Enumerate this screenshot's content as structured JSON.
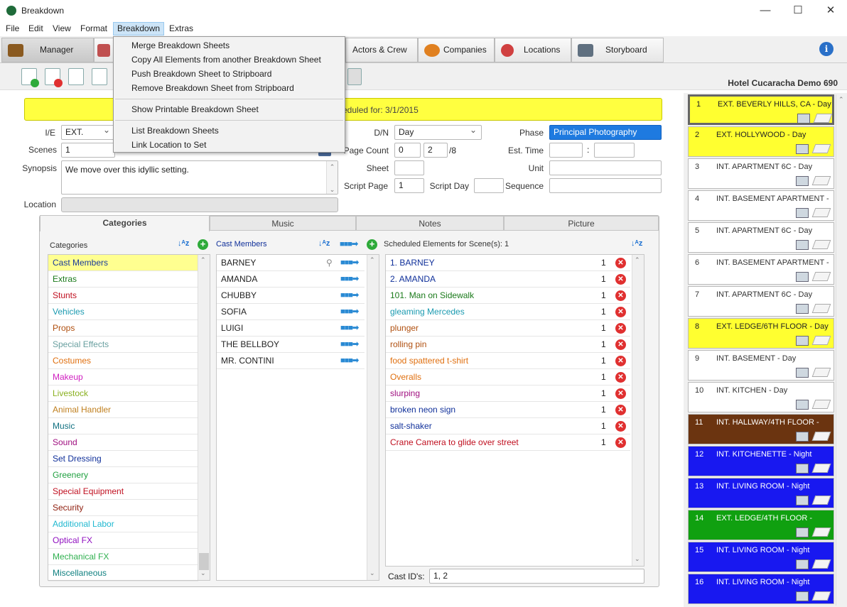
{
  "window": {
    "title": "Breakdown",
    "minimize": "—",
    "maximize": "☐",
    "close": "✕"
  },
  "menubar": [
    "File",
    "Edit",
    "View",
    "Format",
    "Breakdown",
    "Extras"
  ],
  "main_tabs": [
    {
      "label": "Manager",
      "icon": "briefcase-icon"
    },
    {
      "label": "Actors & Crew",
      "icon": "actors-icon"
    },
    {
      "label": "Companies",
      "icon": "companies-icon"
    },
    {
      "label": "Locations",
      "icon": "locations-icon"
    },
    {
      "label": "Storyboard",
      "icon": "storyboard-icon"
    }
  ],
  "project_name": "Hotel Cucaracha Demo 690",
  "breakdown_menu": {
    "items": [
      "Merge Breakdown Sheets",
      "Copy All Elements from another Breakdown Sheet",
      "Push Breakdown Sheet to Stripboard",
      "Remove Breakdown Sheet from Stripboard",
      "Show Printable Breakdown Sheet",
      "List Breakdown Sheets",
      "Link Location to Set"
    ]
  },
  "header_bar": {
    "text": "eduled for: 3/1/2015"
  },
  "form": {
    "ie_label": "I/E",
    "ie_value": "EXT.",
    "scenes_label": "Scenes",
    "scenes_value": "1",
    "synopsis_label": "Synopsis",
    "synopsis_value": "We move over this idyllic setting.",
    "location_label": "Location",
    "dn_label": "D/N",
    "dn_value": "Day",
    "phase_label": "Phase",
    "phase_value": "Principal Photography",
    "pagecount_label": "Page Count",
    "pagecount_whole": "0",
    "pagecount_num": "2",
    "pagecount_den": "/8",
    "esttime_label": "Est. Time",
    "esttime_sep": ":",
    "sheet_label": "Sheet",
    "unit_label": "Unit",
    "scriptpage_label": "Script Page",
    "scriptpage_value": "1",
    "scriptday_label": "Script Day",
    "sequence_label": "Sequence"
  },
  "panel_tabs": [
    "Categories",
    "Music",
    "Notes",
    "Picture"
  ],
  "categories": {
    "header": "Categories",
    "items": [
      {
        "label": "Cast Members",
        "color": "#1a3a9a"
      },
      {
        "label": "Extras",
        "color": "#1a7a1a"
      },
      {
        "label": "Stunts",
        "color": "#c01020"
      },
      {
        "label": "Vehicles",
        "color": "#1a9ab0"
      },
      {
        "label": "Props",
        "color": "#b05010"
      },
      {
        "label": "Special Effects",
        "color": "#6aa0a0"
      },
      {
        "label": "Costumes",
        "color": "#e07010"
      },
      {
        "label": "Makeup",
        "color": "#d020c0"
      },
      {
        "label": "Livestock",
        "color": "#8ab020"
      },
      {
        "label": "Animal Handler",
        "color": "#c08020"
      },
      {
        "label": "Music",
        "color": "#107080"
      },
      {
        "label": "Sound",
        "color": "#a01080"
      },
      {
        "label": "Set Dressing",
        "color": "#10309a"
      },
      {
        "label": "Greenery",
        "color": "#20a040"
      },
      {
        "label": "Special Equipment",
        "color": "#c01020"
      },
      {
        "label": "Security",
        "color": "#902010"
      },
      {
        "label": "Additional Labor",
        "color": "#20b8d0"
      },
      {
        "label": "Optical FX",
        "color": "#9010c0"
      },
      {
        "label": "Mechanical FX",
        "color": "#30b050"
      },
      {
        "label": "Miscellaneous",
        "color": "#108080"
      }
    ]
  },
  "cast": {
    "header": "Cast Members",
    "items": [
      "BARNEY",
      "AMANDA",
      "CHUBBY",
      "SOFIA",
      "LUIGI",
      "THE BELLBOY",
      "MR. CONTINI"
    ]
  },
  "scheduled": {
    "header": "Scheduled Elements for Scene(s): 1",
    "items": [
      {
        "label": "1. BARNEY",
        "qty": "1",
        "color": "#10309a"
      },
      {
        "label": "2. AMANDA",
        "qty": "1",
        "color": "#10309a"
      },
      {
        "label": "101. Man on Sidewalk",
        "qty": "1",
        "color": "#1a7a1a"
      },
      {
        "label": "gleaming Mercedes",
        "qty": "1",
        "color": "#1a9ab0"
      },
      {
        "label": "plunger",
        "qty": "1",
        "color": "#b05010"
      },
      {
        "label": "rolling pin",
        "qty": "1",
        "color": "#b05010"
      },
      {
        "label": "food spattered t-shirt",
        "qty": "1",
        "color": "#e07010"
      },
      {
        "label": "Overalls",
        "qty": "1",
        "color": "#e07010"
      },
      {
        "label": "slurping",
        "qty": "1",
        "color": "#a01080"
      },
      {
        "label": "broken neon sign",
        "qty": "1",
        "color": "#10309a"
      },
      {
        "label": "salt-shaker",
        "qty": "1",
        "color": "#10309a"
      },
      {
        "label": "Crane Camera to glide over street",
        "qty": "1",
        "color": "#c01020"
      }
    ],
    "cast_ids_label": "Cast ID's:",
    "cast_ids_value": "1, 2"
  },
  "strips": [
    {
      "num": "1",
      "text": "EXT. BEVERLY HILLS, CA  - Day",
      "bg": "#ffff30",
      "fg": "#222"
    },
    {
      "num": "2",
      "text": "EXT. HOLLYWOOD  - Day",
      "bg": "#ffff30",
      "fg": "#222"
    },
    {
      "num": "3",
      "text": "INT. APARTMENT 6C  - Day",
      "bg": "#ffffff",
      "fg": "#333"
    },
    {
      "num": "4",
      "text": "INT. BASEMENT APARTMENT  -",
      "bg": "#ffffff",
      "fg": "#333"
    },
    {
      "num": "5",
      "text": "INT. APARTMENT 6C  - Day",
      "bg": "#ffffff",
      "fg": "#333"
    },
    {
      "num": "6",
      "text": "INT. BASEMENT APARTMENT  -",
      "bg": "#ffffff",
      "fg": "#333"
    },
    {
      "num": "7",
      "text": "INT. APARTMENT 6C  - Day",
      "bg": "#ffffff",
      "fg": "#333"
    },
    {
      "num": "8",
      "text": "EXT. LEDGE/6TH FLOOR  - Day",
      "bg": "#ffff30",
      "fg": "#222"
    },
    {
      "num": "9",
      "text": "INT. BASEMENT  - Day",
      "bg": "#ffffff",
      "fg": "#333"
    },
    {
      "num": "10",
      "text": "INT. KITCHEN  - Day",
      "bg": "#ffffff",
      "fg": "#333"
    },
    {
      "num": "11",
      "text": "INT. HALLWAY/4TH FLOOR  -",
      "bg": "#6b3410",
      "fg": "#ffffff"
    },
    {
      "num": "12",
      "text": "INT. KITCHENETTE  - Night",
      "bg": "#1818f0",
      "fg": "#ffffff"
    },
    {
      "num": "13",
      "text": "INT. LIVING ROOM  - Night",
      "bg": "#1818f0",
      "fg": "#ffffff"
    },
    {
      "num": "14",
      "text": "EXT. LEDGE/4TH FLOOR  -",
      "bg": "#10a010",
      "fg": "#ffffff"
    },
    {
      "num": "15",
      "text": "INT. LIVING ROOM  - Night",
      "bg": "#1818f0",
      "fg": "#ffffff"
    },
    {
      "num": "16",
      "text": "INT. LIVING ROOM  - Night",
      "bg": "#1818f0",
      "fg": "#ffffff"
    }
  ]
}
